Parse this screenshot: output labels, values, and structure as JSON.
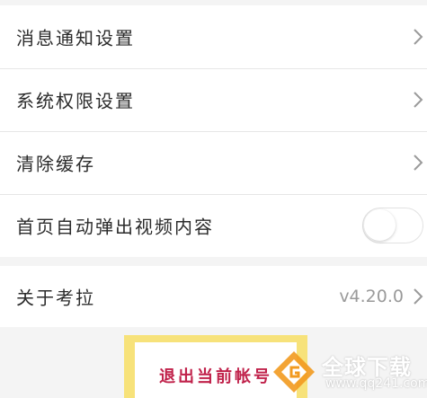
{
  "settings": {
    "items": [
      {
        "label": "消息通知设置",
        "icon": "chevron-right-icon"
      },
      {
        "label": "系统权限设置",
        "icon": "chevron-right-icon"
      },
      {
        "label": "清除缓存",
        "icon": "chevron-right-icon"
      },
      {
        "label": "首页自动弹出视频内容",
        "toggle": false
      }
    ]
  },
  "about": {
    "label": "关于考拉",
    "version": "v4.20.0",
    "icon": "chevron-right-icon"
  },
  "logout": {
    "label": "退出当前帐号"
  },
  "watermark": {
    "title": "全球下载",
    "url": "www.qq241.com"
  },
  "colors": {
    "background": "#f4f4f4",
    "row_text": "#2b2b2b",
    "secondary_text": "#9a9a9a",
    "logout_text": "#c0214a",
    "highlight": "#f7e27a",
    "watermark_orange": "#f29a1f"
  }
}
